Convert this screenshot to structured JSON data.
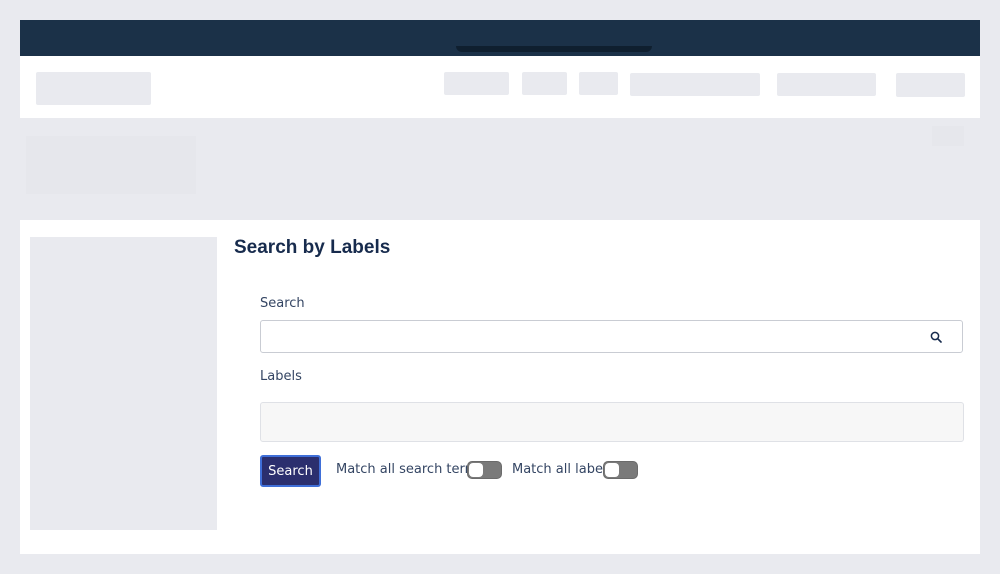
{
  "page": {
    "title": "Search by Labels"
  },
  "search": {
    "label": "Search",
    "value": "",
    "placeholder": ""
  },
  "labels": {
    "label": "Labels"
  },
  "actions": {
    "search_button": "Search"
  },
  "toggles": [
    {
      "label": "Match all search terms",
      "checked": false
    },
    {
      "label": "Match all labels",
      "checked": false
    }
  ],
  "colors": {
    "topbar": "#1b3148",
    "button": "#2b2f6e",
    "toggle_off": "#7a7a7a"
  },
  "icons": {
    "search": "search-icon"
  }
}
